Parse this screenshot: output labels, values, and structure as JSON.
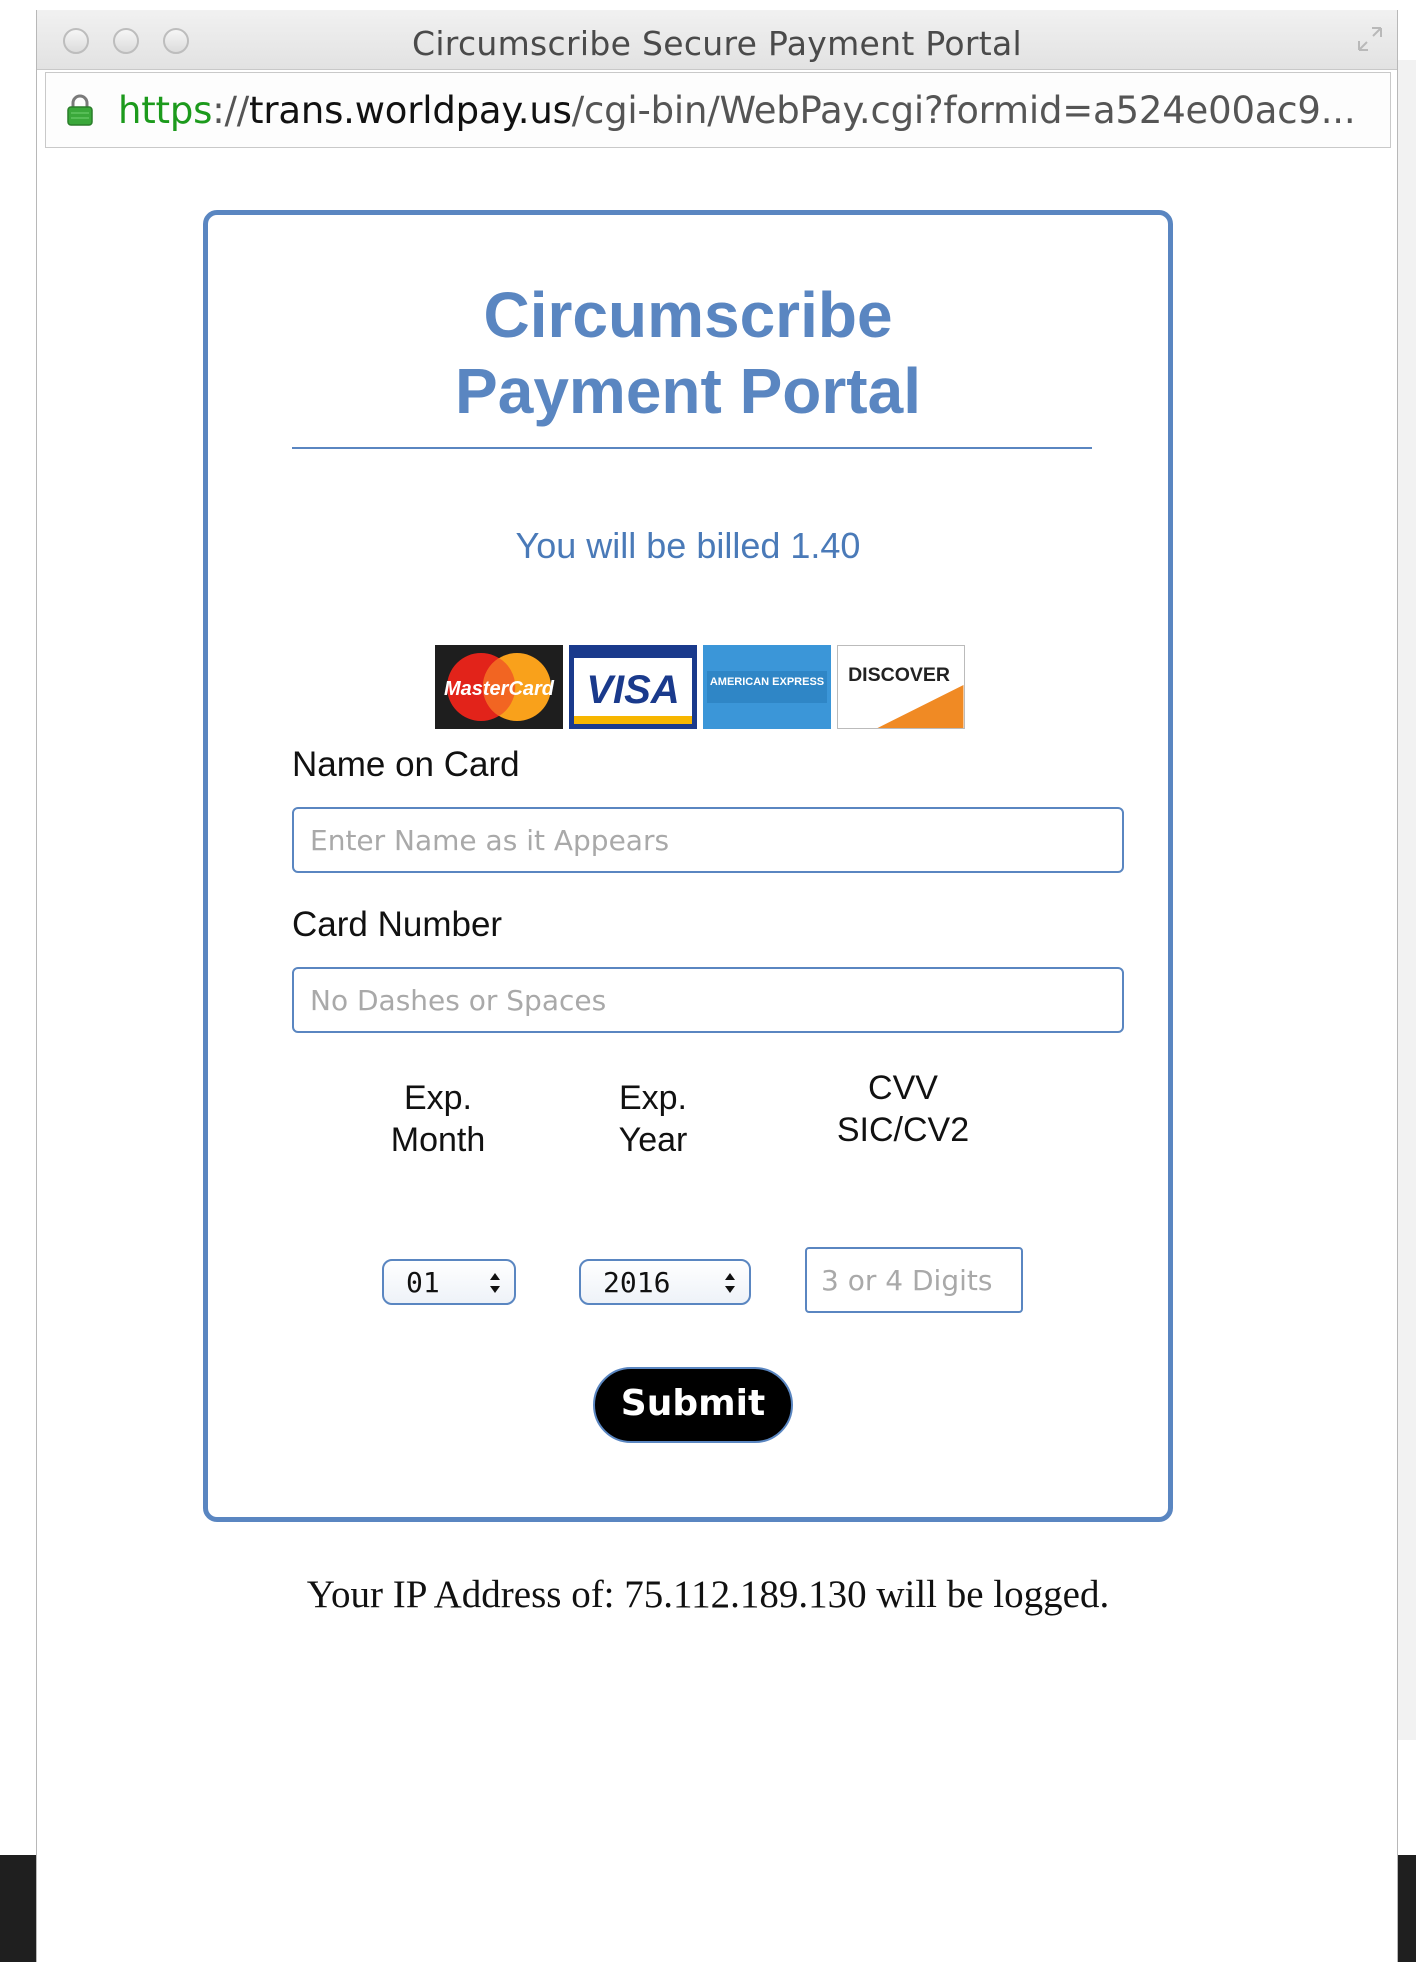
{
  "window": {
    "title": "Circumscribe Secure Payment Portal",
    "url": {
      "scheme": "https",
      "separator": "://",
      "host": "trans.worldpay.us",
      "path": "/cgi-bin/WebPay.cgi?formid=a524e00ac9..."
    }
  },
  "form": {
    "heading_line1": "Circumscribe",
    "heading_line2": "Payment Portal",
    "billed_text": "You will be billed",
    "billed_amount": "1.40",
    "card_logos": [
      "MasterCard",
      "VISA",
      "AMERICAN EXPRESS",
      "DISCOVER"
    ],
    "name_label": "Name on Card",
    "name_placeholder": "Enter Name as it Appears",
    "card_number_label": "Card Number",
    "card_number_placeholder": "No Dashes or Spaces",
    "exp_month_label_1": "Exp.",
    "exp_month_label_2": "Month",
    "exp_month_value": "01",
    "exp_year_label_1": "Exp.",
    "exp_year_label_2": "Year",
    "exp_year_value": "2016",
    "cvv_label_1": "CVV",
    "cvv_label_2": "SIC/CV2",
    "cvv_placeholder": "3 or 4 Digits",
    "submit_label": "Submit"
  },
  "footer": {
    "ip_notice": "Your IP Address of: 75.112.189.130 will be logged."
  },
  "colors": {
    "accent": "#5a86c1",
    "url_scheme": "#1c9a1c"
  }
}
